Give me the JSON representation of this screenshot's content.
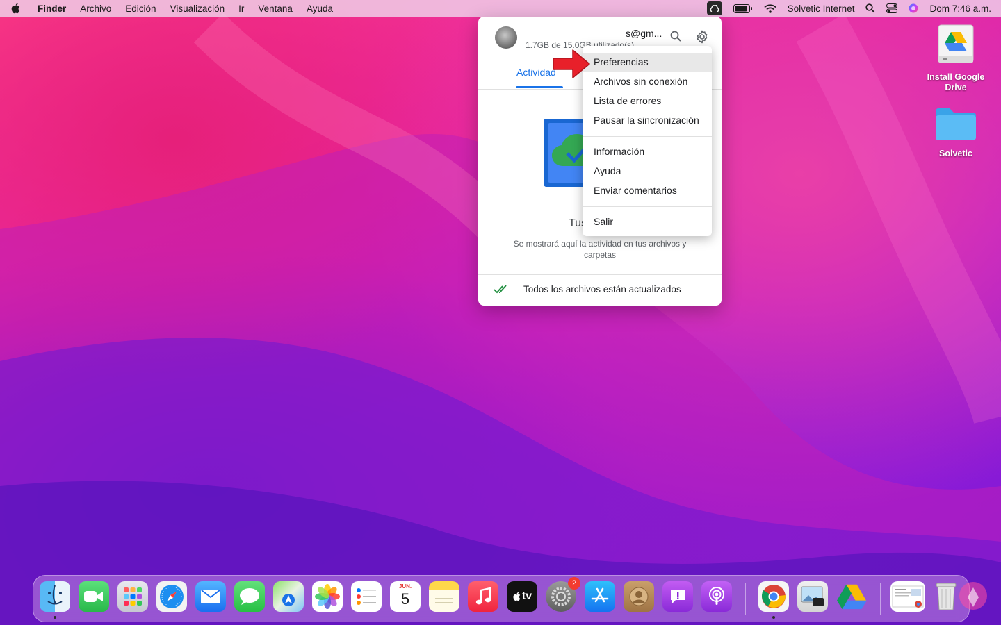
{
  "menubar": {
    "app_name": "Finder",
    "items": [
      "Archivo",
      "Edición",
      "Visualización",
      "Ir",
      "Ventana",
      "Ayuda"
    ],
    "wifi_name": "Solvetic Internet",
    "clock": "Dom 7:46 a.m."
  },
  "desktop": {
    "items": [
      {
        "label": "Install Google Drive",
        "icon": "drive-installer-icon"
      },
      {
        "label": "Solvetic",
        "icon": "folder-icon"
      }
    ]
  },
  "drive_panel": {
    "email": "s@gm...",
    "usage": "1.7GB de 15.0GB utilizado(s)",
    "tab_label": "Actividad",
    "empty_title": "Tus archivos",
    "empty_description": "Se mostrará aquí la actividad en tus archivos y carpetas",
    "sync_status": "Todos los archivos están actualizados",
    "accent_color": "#1a73e8"
  },
  "settings_menu": {
    "items": [
      "Preferencias",
      "Archivos sin conexión",
      "Lista de errores",
      "Pausar la sincronización",
      "Información",
      "Ayuda",
      "Enviar comentarios",
      "Salir"
    ],
    "highlighted": "Preferencias"
  },
  "dock": {
    "apps": [
      "finder-icon",
      "facetime-icon",
      "launchpad-icon",
      "safari-icon",
      "mail-icon",
      "messages-icon",
      "maps-icon",
      "photos-icon",
      "reminders-icon",
      "calendar-icon",
      "notes-icon",
      "music-icon",
      "appletv-icon",
      "system-preferences-icon",
      "app-store-icon",
      "contacts-icon",
      "feedback-assistant-icon",
      "podcasts-icon",
      "chrome-icon",
      "preview-icon",
      "google-drive-icon",
      "downloads-icon",
      "trash-icon"
    ],
    "calendar_month": "JUN.",
    "calendar_day": "5",
    "appletv_label": "tv",
    "system_prefs_badge": "2"
  }
}
